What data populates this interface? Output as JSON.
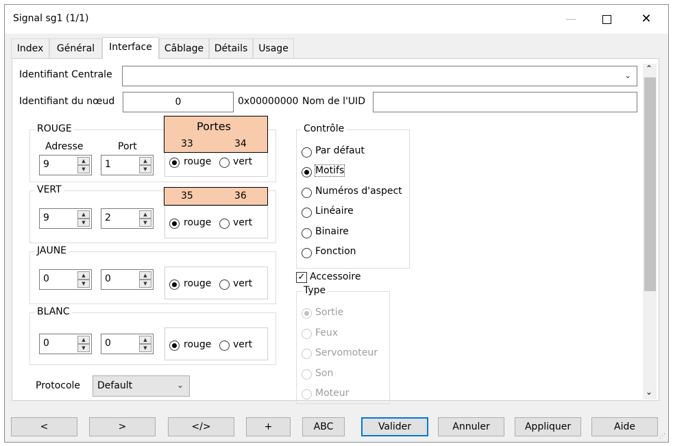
{
  "window": {
    "title": "Signal sg1 (1/1)",
    "min_glyph": "—",
    "close_glyph": "✕"
  },
  "tabs": [
    {
      "label": "Index"
    },
    {
      "label": "Général"
    },
    {
      "label": "Interface"
    },
    {
      "label": "Câblage"
    },
    {
      "label": "Détails"
    },
    {
      "label": "Usage"
    }
  ],
  "interface": {
    "central_id_label": "Identifiant Centrale",
    "central_id_value": "",
    "node_id_label": "Identifiant du nœud",
    "node_id_value": "0",
    "hex_value": "0x00000000",
    "uid_name_label": "Nom de l'UID",
    "uid_name_value": "",
    "address_label": "Adresse",
    "port_label": "Port",
    "radio_rouge": "rouge",
    "radio_vert": "vert",
    "groups": [
      {
        "name": "ROUGE",
        "address": "9",
        "port": "1"
      },
      {
        "name": "VERT",
        "address": "9",
        "port": "2"
      },
      {
        "name": "JAUNE",
        "address": "0",
        "port": "0"
      },
      {
        "name": "BLANC",
        "address": "0",
        "port": "0"
      }
    ],
    "protocol_label": "Protocole",
    "protocol_value": "Default"
  },
  "annotation": {
    "title": "Portes",
    "row1": [
      "33",
      "34"
    ],
    "row2": [
      "35",
      "36"
    ]
  },
  "control": {
    "title": "Contrôle",
    "options": [
      "Par défaut",
      "Motifs",
      "Numéros d'aspect",
      "Linéaire",
      "Binaire",
      "Fonction"
    ],
    "selected": "Motifs"
  },
  "accessory": {
    "label": "Accessoire",
    "checked": true,
    "type_title": "Type",
    "types": [
      "Sortie",
      "Feux",
      "Servomoteur",
      "Son",
      "Moteur"
    ],
    "selected": "Sortie"
  },
  "buttons": {
    "prev": "<",
    "next": ">",
    "code": "</>",
    "plus": "+",
    "abc": "ABC",
    "validate": "Valider",
    "cancel": "Annuler",
    "apply": "Appliquer",
    "help": "Aide"
  }
}
